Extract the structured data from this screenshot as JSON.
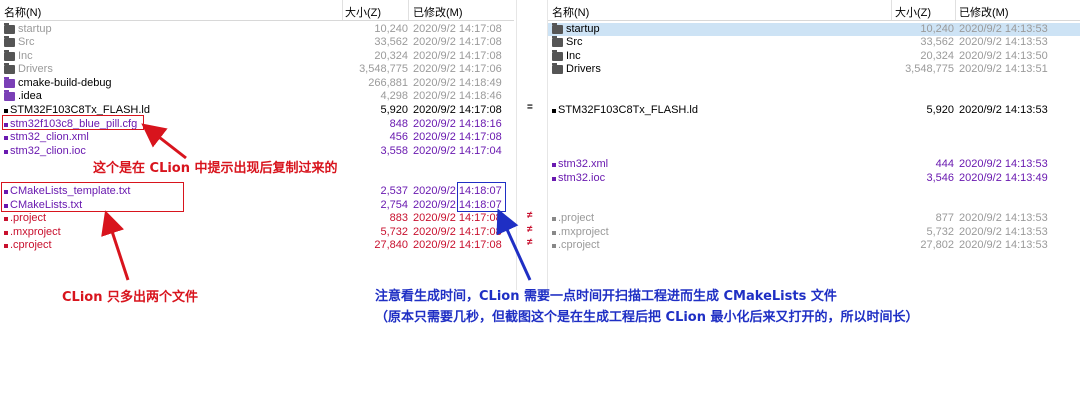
{
  "left_pane": {
    "header": {
      "name": "名称(N)",
      "size": "大小(Z)",
      "modified": "已修改(M)"
    },
    "rows": [
      {
        "icon": "folder-icon",
        "name": "startup",
        "size": "10,240",
        "date": "2020/9/2 14:17:08"
      },
      {
        "icon": "folder-icon",
        "name": "Src",
        "size": "33,562",
        "date": "2020/9/2 14:17:08"
      },
      {
        "icon": "folder-icon",
        "name": "Inc",
        "size": "20,324",
        "date": "2020/9/2 14:17:08"
      },
      {
        "icon": "folder-icon",
        "name": "Drivers",
        "size": "3,548,775",
        "date": "2020/9/2 14:17:06"
      },
      {
        "icon": "folder-icon",
        "name": "cmake-build-debug",
        "size": "266,881",
        "date": "2020/9/2 14:18:49"
      },
      {
        "icon": "folder-icon",
        "name": ".idea",
        "size": "4,298",
        "date": "2020/9/2 14:18:46"
      },
      {
        "icon": "file-icon",
        "name": "STM32F103C8Tx_FLASH.ld",
        "size": "5,920",
        "date": "2020/9/2 14:17:08"
      },
      {
        "icon": "file-icon",
        "name": "stm32f103c8_blue_pill.cfg",
        "size": "848",
        "date": "2020/9/2 14:18:16"
      },
      {
        "icon": "file-icon",
        "name": "stm32_clion.xml",
        "size": "456",
        "date": "2020/9/2 14:17:08"
      },
      {
        "icon": "file-icon",
        "name": "stm32_clion.ioc",
        "size": "3,558",
        "date": "2020/9/2 14:17:04"
      },
      {
        "icon": "file-icon",
        "name": "CMakeLists_template.txt",
        "size": "2,537",
        "date": "2020/9/2 14:18:07"
      },
      {
        "icon": "file-icon",
        "name": "CMakeLists.txt",
        "size": "2,754",
        "date": "2020/9/2 14:18:07"
      },
      {
        "icon": "file-icon",
        "name": ".project",
        "size": "883",
        "date": "2020/9/2 14:17:08"
      },
      {
        "icon": "file-icon",
        "name": ".mxproject",
        "size": "5,732",
        "date": "2020/9/2 14:17:08"
      },
      {
        "icon": "file-icon",
        "name": ".cproject",
        "size": "27,840",
        "date": "2020/9/2 14:17:08"
      }
    ]
  },
  "right_pane": {
    "header": {
      "name": "名称(N)",
      "size": "大小(Z)",
      "modified": "已修改(M)"
    },
    "rows": [
      {
        "icon": "folder-icon",
        "name": "startup",
        "size": "10,240",
        "date": "2020/9/2 14:13:53"
      },
      {
        "icon": "folder-icon",
        "name": "Src",
        "size": "33,562",
        "date": "2020/9/2 14:13:53"
      },
      {
        "icon": "folder-icon",
        "name": "Inc",
        "size": "20,324",
        "date": "2020/9/2 14:13:50"
      },
      {
        "icon": "folder-icon",
        "name": "Drivers",
        "size": "3,548,775",
        "date": "2020/9/2 14:13:51"
      },
      {
        "icon": "file-icon",
        "name": "STM32F103C8Tx_FLASH.ld",
        "size": "5,920",
        "date": "2020/9/2 14:13:53"
      },
      {
        "icon": "file-icon",
        "name": "stm32.xml",
        "size": "444",
        "date": "2020/9/2 14:13:53"
      },
      {
        "icon": "file-icon",
        "name": "stm32.ioc",
        "size": "3,546",
        "date": "2020/9/2 14:13:49"
      },
      {
        "icon": "file-icon",
        "name": ".project",
        "size": "877",
        "date": "2020/9/2 14:13:53"
      },
      {
        "icon": "file-icon",
        "name": ".mxproject",
        "size": "5,732",
        "date": "2020/9/2 14:13:53"
      },
      {
        "icon": "file-icon",
        "name": ".cproject",
        "size": "27,802",
        "date": "2020/9/2 14:13:53"
      }
    ]
  },
  "compare_marks": {
    "ld": "=",
    "project": "≠",
    "mxproject": "≠",
    "cproject": "≠"
  },
  "annotations": {
    "cfg_note": "这个是在 CLion 中提示出现后复制过来的",
    "two_files_note": "CLion 只多出两个文件",
    "time_note_line1": "注意看生成时间，CLion 需要一点时间开扫描工程进而生成 CMakeLists 文件",
    "time_note_line2": "（原本只需要几秒，但截图这个是在生成工程后把 CLion 最小化后来又打开的，所以时间长）"
  },
  "colors": {
    "grey": "#9a9a9a",
    "purple": "#6a1ab0",
    "red": "#c8102e",
    "annotation_red": "#d8141d",
    "annotation_blue": "#1f2fc4",
    "selection": "#cde3f5"
  }
}
